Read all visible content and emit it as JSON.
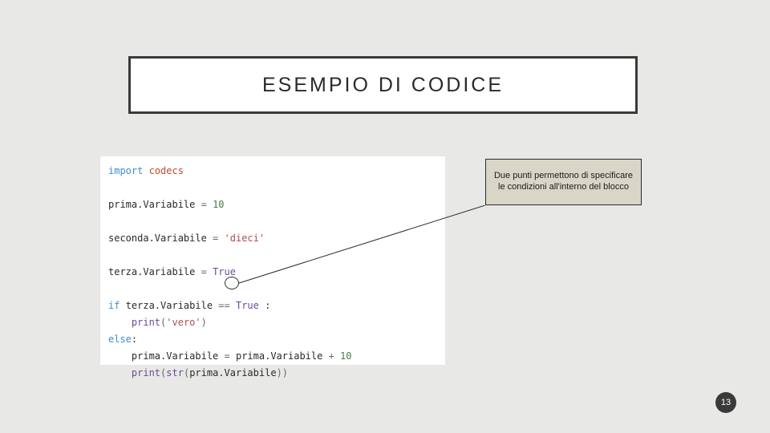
{
  "title": "ESEMPIO DI CODICE",
  "callout": "Due punti permettono di specificare le condizioni all'interno del blocco",
  "page_number": "13",
  "code": {
    "line1_kw": "import",
    "line1_mod": "codecs",
    "line2_var": "prima.Variabile",
    "line2_eq": " = ",
    "line2_val": "10",
    "line3_var": "seconda.Variabile",
    "line3_eq": " = ",
    "line3_val": "'dieci'",
    "line4_var": "terza.Variabile",
    "line4_eq": " = ",
    "line4_val": "True",
    "line5_if": "if",
    "line5_sp": " ",
    "line5_var": "terza.Variabile",
    "line5_op": " == ",
    "line5_val": "True",
    "line5_colon": " :",
    "line6_indent": "    ",
    "line6_fn": "print",
    "line6_open": "(",
    "line6_arg": "'vero'",
    "line6_close": ")",
    "line7_else": "else",
    "line7_colon": ":",
    "line8_indent": "    ",
    "line8_var": "prima.Variabile",
    "line8_eq": " = ",
    "line8_var2": "prima.Variabile",
    "line8_op": " + ",
    "line8_num": "10",
    "line9_indent": "    ",
    "line9_fn": "print",
    "line9_open": "(",
    "line9_str": "str",
    "line9_open2": "(",
    "line9_var": "prima.Variabile",
    "line9_close2": ")",
    "line9_close": ")"
  }
}
